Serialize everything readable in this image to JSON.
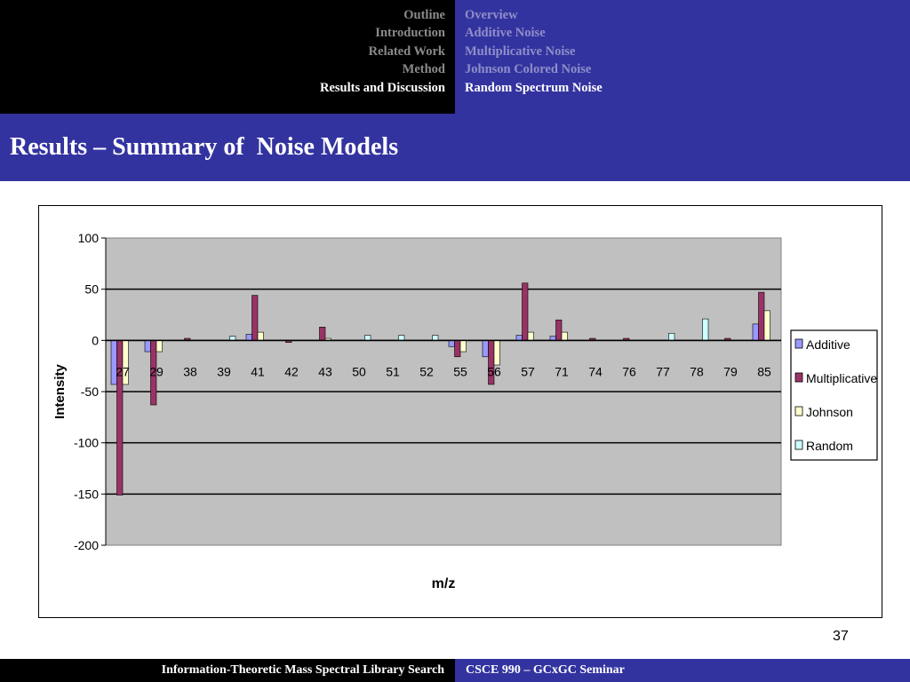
{
  "nav": {
    "left": [
      {
        "label": "Outline",
        "active": false
      },
      {
        "label": "Introduction",
        "active": false
      },
      {
        "label": "Related Work",
        "active": false
      },
      {
        "label": "Method",
        "active": false
      },
      {
        "label": "Results and Discussion",
        "active": true
      }
    ],
    "right": [
      {
        "label": "Overview",
        "active": false
      },
      {
        "label": "Additive Noise",
        "active": false
      },
      {
        "label": "Multiplicative Noise",
        "active": false
      },
      {
        "label": "Johnson Colored Noise",
        "active": false
      },
      {
        "label": "Random Spectrum Noise",
        "active": true
      }
    ]
  },
  "slide": {
    "title": "Results – Summary of  Noise Models",
    "page_number": "37"
  },
  "footer": {
    "left": "Information-Theoretic Mass Spectral Library Search",
    "right": "CSCE 990 – GCxGC Seminar"
  },
  "colors": {
    "header_dark": "#000000",
    "header_blue": "#3333a0",
    "additive": "#9999ff",
    "multiplicative": "#993366",
    "johnson": "#ffffcc",
    "random": "#ccffff",
    "plot_area": "#c0c0c0"
  },
  "chart_data": {
    "type": "bar",
    "xlabel": "m/z",
    "ylabel": "Intensity",
    "ylim": [
      -200,
      100
    ],
    "yticks": [
      100,
      50,
      0,
      -50,
      -100,
      -150,
      -200
    ],
    "grid": true,
    "legend_position": "right",
    "categories": [
      "27",
      "29",
      "38",
      "39",
      "41",
      "42",
      "43",
      "50",
      "51",
      "52",
      "55",
      "56",
      "57",
      "71",
      "74",
      "76",
      "77",
      "78",
      "79",
      "85"
    ],
    "series": [
      {
        "name": "Additive",
        "color": "#9999ff",
        "values": [
          -43,
          -11,
          0,
          0,
          6,
          0,
          0,
          0,
          0,
          0,
          -6,
          -16,
          5,
          4,
          0,
          0,
          0,
          0,
          0,
          16
        ]
      },
      {
        "name": "Multiplicative",
        "color": "#993366",
        "values": [
          -151,
          -63,
          2,
          0,
          44,
          -2,
          13,
          0,
          0,
          0,
          -16,
          -43,
          56,
          20,
          2,
          2,
          0,
          0,
          2,
          47
        ]
      },
      {
        "name": "Johnson",
        "color": "#ffffcc",
        "values": [
          -43,
          -11,
          0,
          0,
          8,
          0,
          2,
          0,
          0,
          0,
          -11,
          -24,
          8,
          8,
          0,
          0,
          0,
          0,
          0,
          29
        ]
      },
      {
        "name": "Random",
        "color": "#ccffff",
        "values": [
          0,
          0,
          0,
          4,
          0,
          0,
          0,
          5,
          5,
          5,
          0,
          0,
          0,
          0,
          0,
          0,
          7,
          21,
          0,
          0
        ]
      }
    ]
  }
}
